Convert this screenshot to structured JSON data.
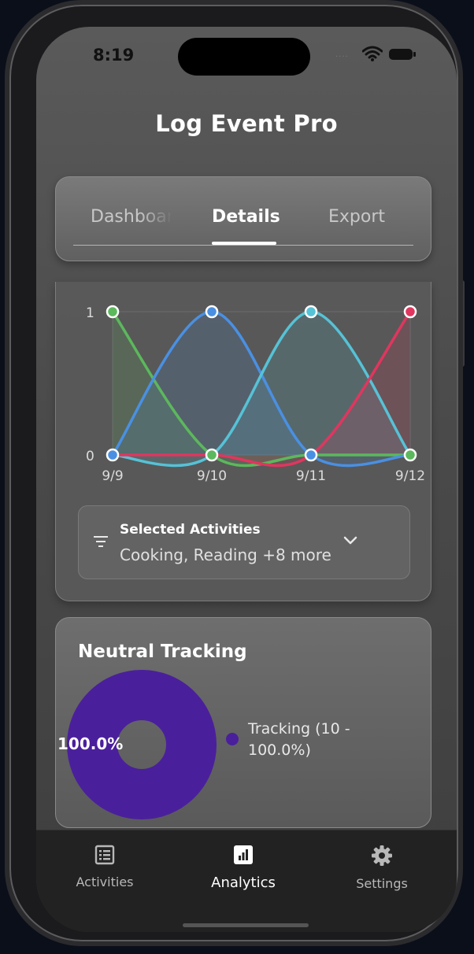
{
  "status_bar": {
    "time": "8:19",
    "signal_dots": "...."
  },
  "app": {
    "title": "Log Event Pro"
  },
  "tabs": [
    {
      "label": "Dashboard",
      "active": false
    },
    {
      "label": "Details",
      "active": true
    },
    {
      "label": "Export",
      "active": false
    }
  ],
  "chart_data": {
    "type": "line",
    "x": [
      "9/9",
      "9/10",
      "9/11",
      "9/12"
    ],
    "y_ticks": [
      "0",
      "1"
    ],
    "ylim": [
      0,
      1
    ],
    "grid": true,
    "series": [
      {
        "color": "#5cb85c",
        "values": [
          1,
          0,
          0,
          0
        ]
      },
      {
        "color": "#4a90e2",
        "values": [
          0,
          1,
          0,
          0
        ]
      },
      {
        "color": "#56c2d6",
        "values": [
          0,
          0,
          1,
          0
        ]
      },
      {
        "color": "#e0365f",
        "values": [
          0,
          0,
          0,
          1
        ]
      }
    ]
  },
  "filter": {
    "label": "Selected Activities",
    "value": "Cooking, Reading +8 more"
  },
  "pie": {
    "title": "Neutral Tracking",
    "percent_label": "100.0%",
    "legend_label": "Tracking (10 - 100.0%)",
    "color": "#4a1f9c",
    "slices": [
      {
        "label": "Tracking",
        "count": 10,
        "percent": 100.0
      }
    ]
  },
  "nav": [
    {
      "label": "Activities",
      "icon": "list-icon",
      "active": false
    },
    {
      "label": "Analytics",
      "icon": "analytics-icon",
      "active": true
    },
    {
      "label": "Settings",
      "icon": "gear-icon",
      "active": false
    }
  ]
}
